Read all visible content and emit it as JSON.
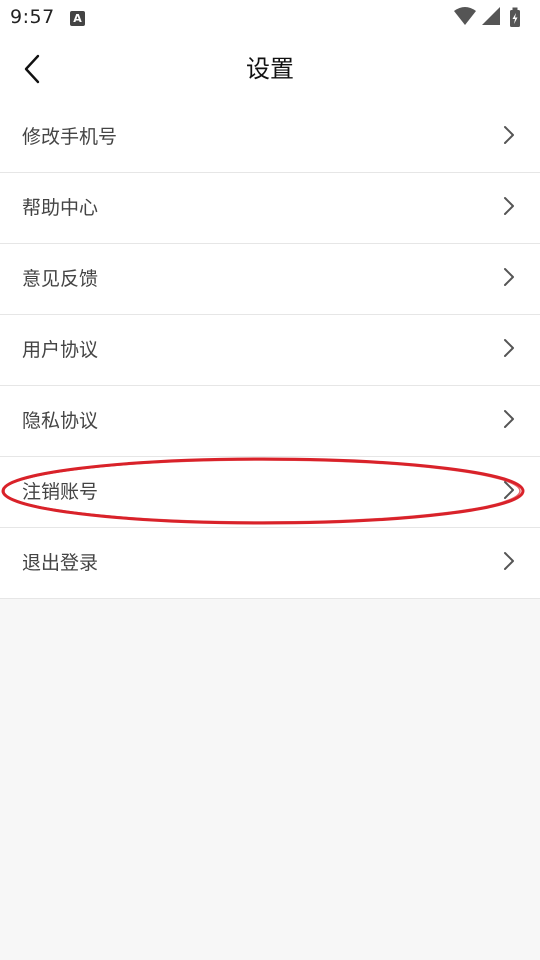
{
  "status_bar": {
    "time": "9:57",
    "notification_icon": "A",
    "icons": [
      "wifi-icon",
      "cellular-signal-icon",
      "battery-charging-icon"
    ]
  },
  "header": {
    "title": "设置",
    "back_icon": "chevron-left-icon"
  },
  "settings": {
    "items": [
      {
        "label": "修改手机号",
        "icon": "chevron-right-icon"
      },
      {
        "label": "帮助中心",
        "icon": "chevron-right-icon"
      },
      {
        "label": "意见反馈",
        "icon": "chevron-right-icon"
      },
      {
        "label": "用户协议",
        "icon": "chevron-right-icon"
      },
      {
        "label": "隐私协议",
        "icon": "chevron-right-icon"
      },
      {
        "label": "注销账号",
        "icon": "chevron-right-icon",
        "highlighted": true
      },
      {
        "label": "退出登录",
        "icon": "chevron-right-icon"
      }
    ]
  },
  "colors": {
    "highlight": "#d9222a",
    "text": "#444444",
    "title": "#111111",
    "background": "#f7f7f7",
    "divider": "#e6e6e6"
  }
}
